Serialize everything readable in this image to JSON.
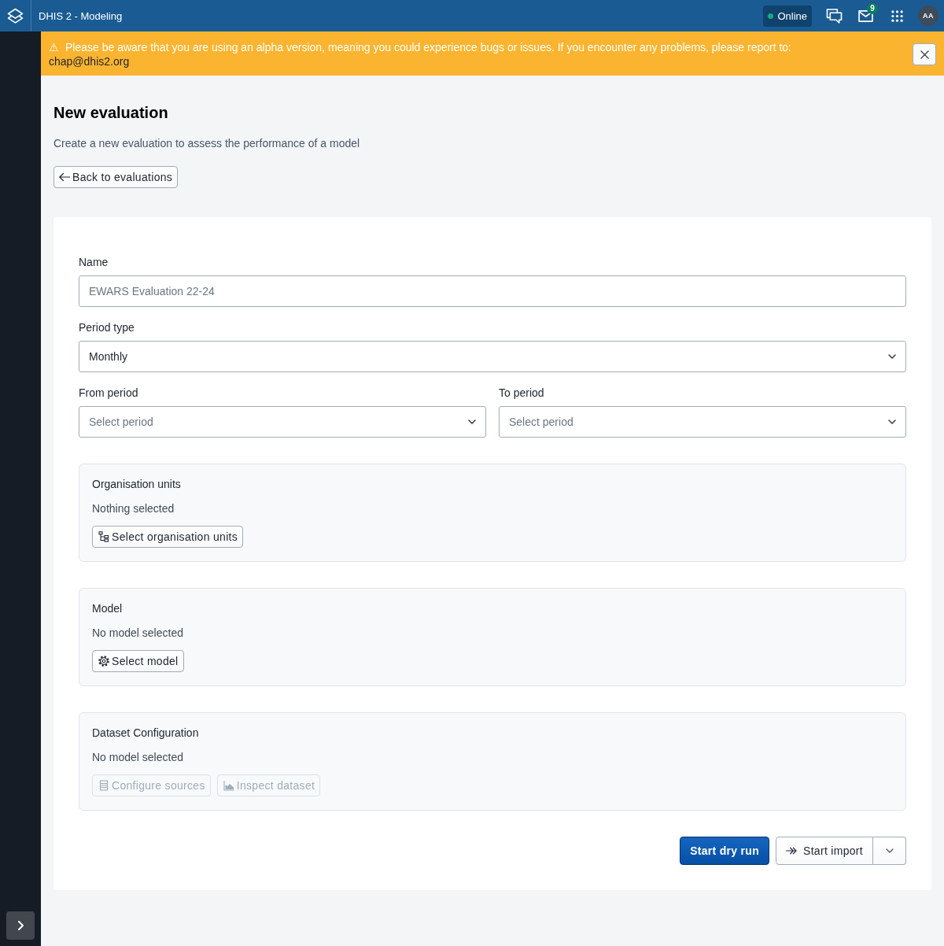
{
  "header": {
    "title": "DHIS 2 - Modeling",
    "status": {
      "label": "Online",
      "online": true
    },
    "message_count": "9",
    "avatar_initials": "AA"
  },
  "alert": {
    "icon": "⚠",
    "message": "Please be aware that you are using an alpha version, meaning you could experience bugs or issues. If you encounter any problems, please report to:",
    "link": "chap@dhis2.org"
  },
  "page": {
    "title": "New evaluation",
    "description": "Create a new evaluation to assess the performance of a model",
    "back_button": "Back to evaluations"
  },
  "form": {
    "fields": [
      {
        "kind": "text",
        "label": "Name",
        "placeholder": "EWARS Evaluation 22-24"
      },
      {
        "kind": "select",
        "label": "Period type",
        "value": "Monthly"
      }
    ],
    "period_fields": [
      {
        "kind": "select",
        "label": "From period",
        "placeholder": "Select period"
      },
      {
        "kind": "select",
        "label": "To period",
        "placeholder": "Select period"
      }
    ],
    "sections": [
      {
        "title": "Organisation units",
        "status": "Nothing selected",
        "buttons": [
          {
            "label": "Select organisation units",
            "disabled": false
          }
        ]
      },
      {
        "title": "Model",
        "status": "No model selected",
        "buttons": [
          {
            "label": "Select model",
            "disabled": false
          }
        ]
      },
      {
        "title": "Dataset Configuration",
        "status": "No model selected",
        "buttons": [
          {
            "label": "Configure sources",
            "disabled": true
          },
          {
            "label": "Inspect dataset",
            "disabled": true
          }
        ]
      }
    ],
    "actions": [
      {
        "kind": "primary",
        "label": "Start dry run"
      },
      {
        "kind": "split",
        "label": "Start import"
      }
    ]
  }
}
